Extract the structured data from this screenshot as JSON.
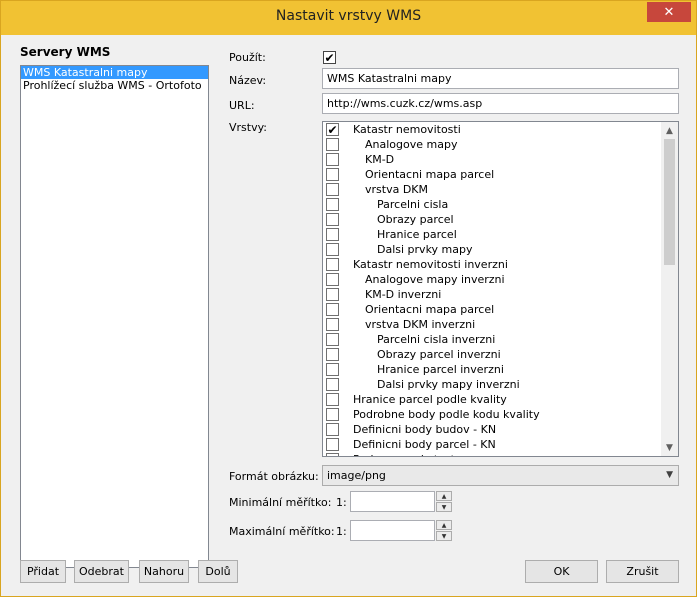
{
  "window": {
    "title": "Nastavit vrstvy WMS",
    "close_glyph": "✕"
  },
  "servers": {
    "heading": "Servery WMS",
    "items": [
      {
        "label": "WMS Katastralni mapy",
        "selected": true
      },
      {
        "label": "Prohlížecí služba WMS - Ortofoto",
        "selected": false
      }
    ]
  },
  "form": {
    "use_label": "Použít:",
    "use_checked": true,
    "name_label": "Název:",
    "name_value": "WMS Katastralni mapy",
    "url_label": "URL:",
    "url_value": "http://wms.cuzk.cz/wms.asp",
    "layers_label": "Vrstvy:",
    "format_label": "Formát obrázku:",
    "format_value": "image/png",
    "min_scale_label": "Minimální měřítko:",
    "max_scale_label": "Maximální měřítko:",
    "scale_prefix": "1:",
    "min_scale_value": "",
    "max_scale_value": ""
  },
  "layers": [
    {
      "label": "Katastr nemovitosti",
      "level": 0,
      "checked": true
    },
    {
      "label": "Analogove mapy",
      "level": 1,
      "checked": false
    },
    {
      "label": "KM-D",
      "level": 1,
      "checked": false
    },
    {
      "label": "Orientacni mapa parcel",
      "level": 1,
      "checked": false
    },
    {
      "label": "vrstva DKM",
      "level": 1,
      "checked": false
    },
    {
      "label": "Parcelni cisla",
      "level": 2,
      "checked": false
    },
    {
      "label": "Obrazy parcel",
      "level": 2,
      "checked": false
    },
    {
      "label": "Hranice parcel",
      "level": 2,
      "checked": false
    },
    {
      "label": "Dalsi prvky mapy",
      "level": 2,
      "checked": false
    },
    {
      "label": "Katastr nemovitosti inverzni",
      "level": 0,
      "checked": false
    },
    {
      "label": "Analogove mapy inverzni",
      "level": 1,
      "checked": false
    },
    {
      "label": "KM-D inverzni",
      "level": 1,
      "checked": false
    },
    {
      "label": "Orientacni mapa parcel",
      "level": 1,
      "checked": false
    },
    {
      "label": "vrstva DKM inverzni",
      "level": 1,
      "checked": false
    },
    {
      "label": "Parcelni cisla inverzni",
      "level": 2,
      "checked": false
    },
    {
      "label": "Obrazy parcel inverzni",
      "level": 2,
      "checked": false
    },
    {
      "label": "Hranice parcel inverzni",
      "level": 2,
      "checked": false
    },
    {
      "label": "Dalsi prvky mapy inverzni",
      "level": 2,
      "checked": false
    },
    {
      "label": "Hranice parcel podle kvality",
      "level": 0,
      "checked": false
    },
    {
      "label": "Podrobne body podle kodu kvality",
      "level": 0,
      "checked": false
    },
    {
      "label": "Definicni body budov - KN",
      "level": 0,
      "checked": false
    },
    {
      "label": "Definicni body parcel - KN",
      "level": 0,
      "checked": false
    },
    {
      "label": "Prvky mapy katastru",
      "level": 0,
      "checked": false
    }
  ],
  "buttons": {
    "add": "Přidat",
    "remove": "Odebrat",
    "up": "Nahoru",
    "down": "Dolů",
    "ok": "OK",
    "cancel": "Zrušit"
  },
  "icons": {
    "check_glyph": "✔",
    "scroll_up": "▲",
    "scroll_down": "▼",
    "dropdown": "▼",
    "spin_up": "▲",
    "spin_down": "▼"
  }
}
